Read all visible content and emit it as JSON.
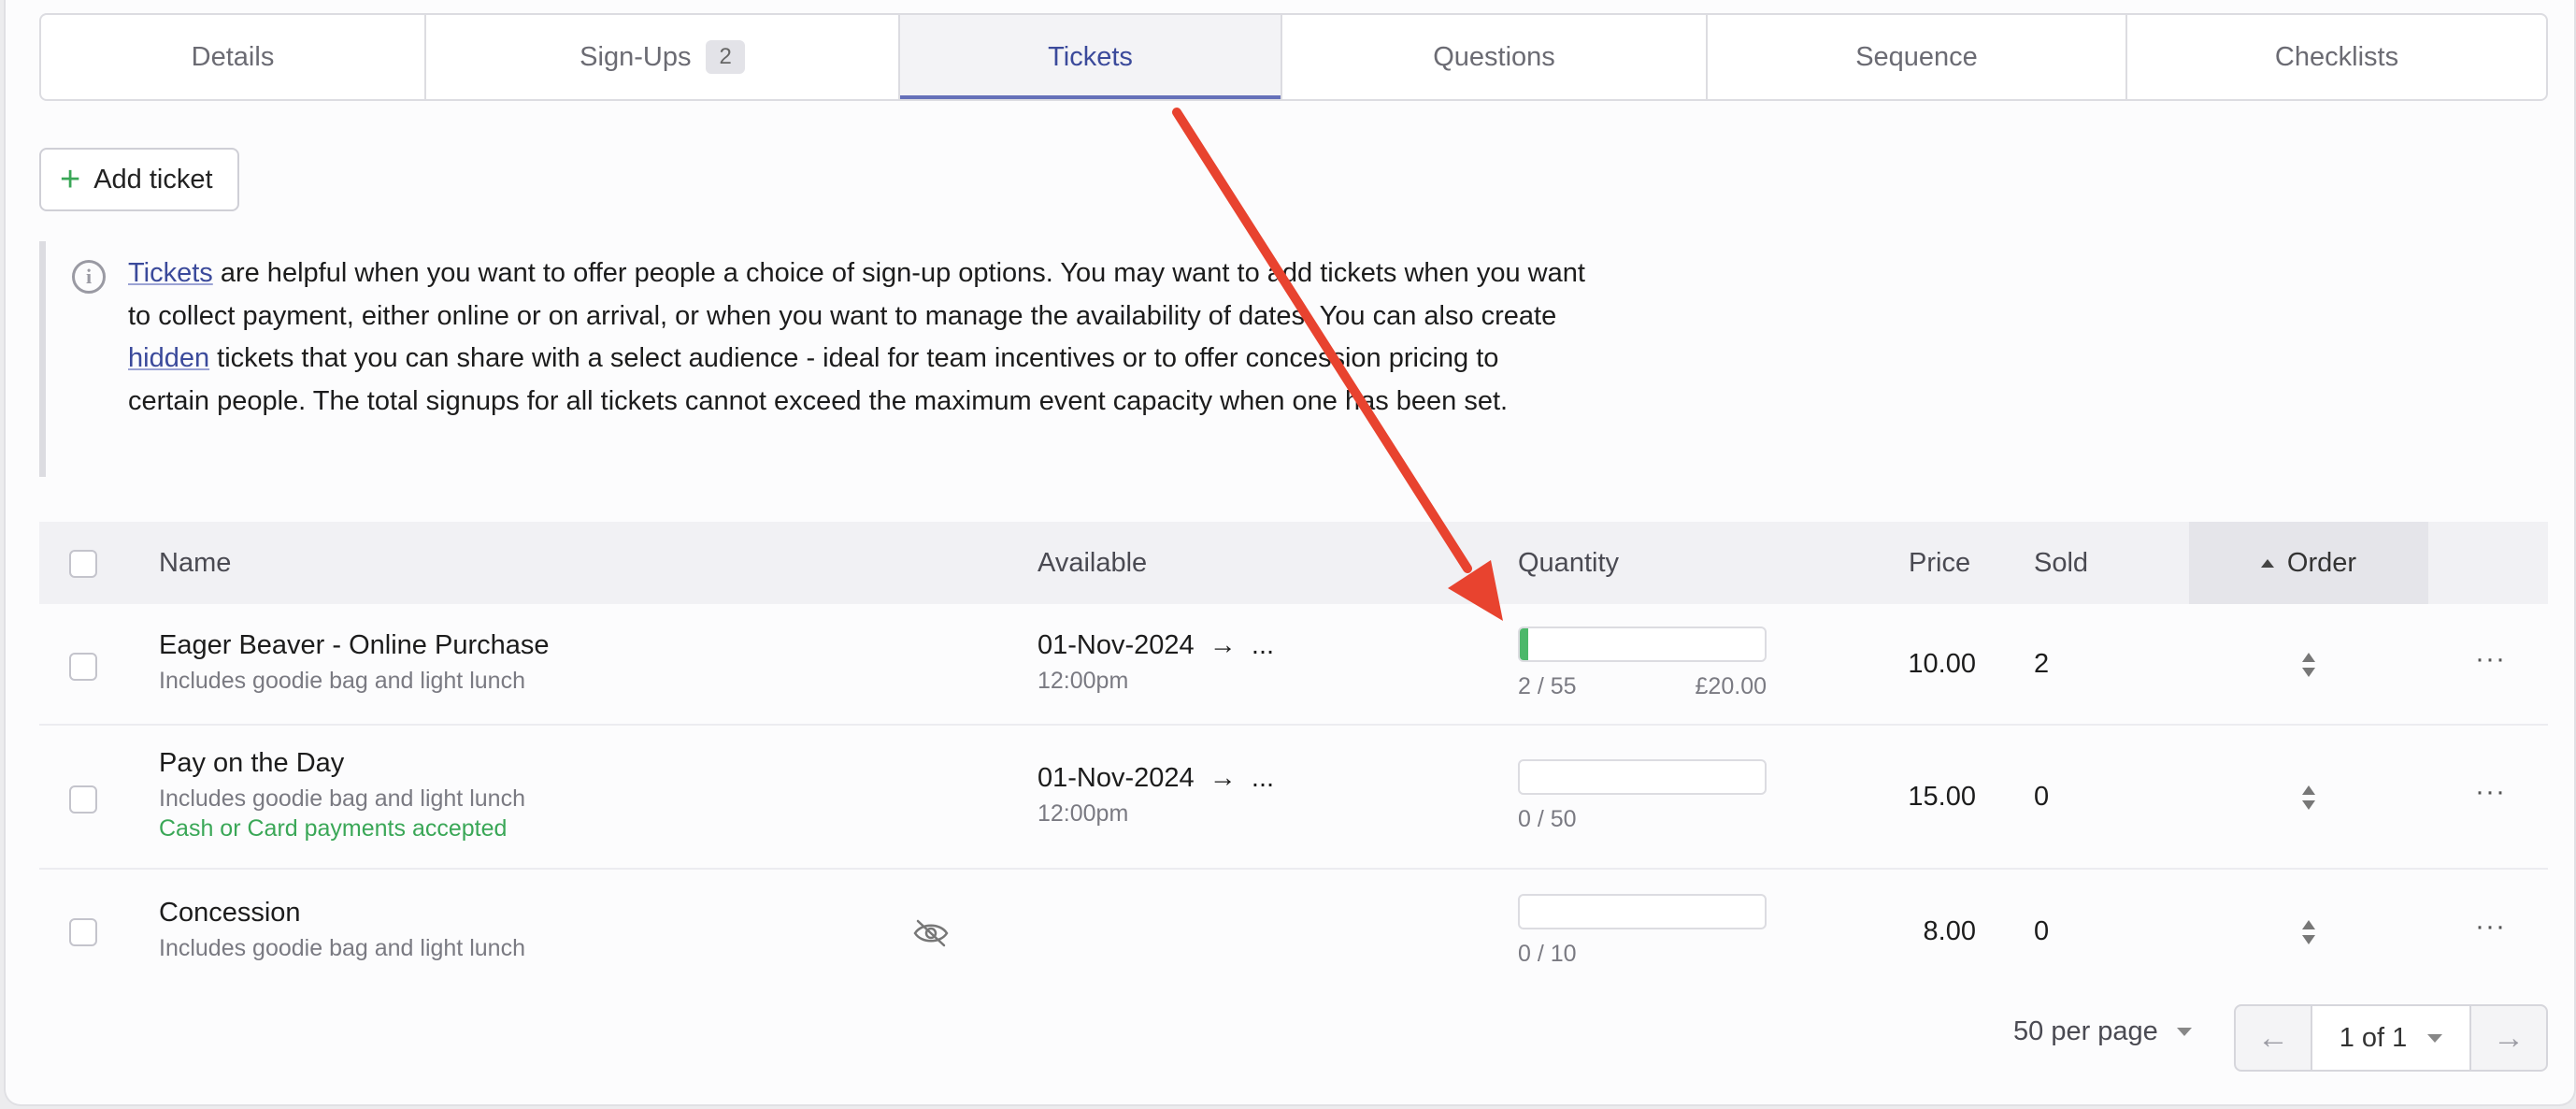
{
  "tabs": [
    {
      "label": "Details"
    },
    {
      "label": "Sign-Ups",
      "badge": "2"
    },
    {
      "label": "Tickets"
    },
    {
      "label": "Questions"
    },
    {
      "label": "Sequence"
    },
    {
      "label": "Checklists"
    }
  ],
  "add_ticket_label": "Add ticket",
  "note": {
    "link_tickets": "Tickets",
    "text_1": " are helpful when you want to offer people a choice of sign-up options. You may want to add tickets when you want to collect payment, either online or on arrival, or when you want to manage the availability of dates. You can also create ",
    "link_hidden": "hidden",
    "text_2": " tickets that you can share with a select audience - ideal for team incentives or to offer concession pricing to certain people. The total signups for all tickets cannot exceed the maximum event capacity when one has been set."
  },
  "table": {
    "headers": {
      "name": "Name",
      "available": "Available",
      "quantity": "Quantity",
      "price": "Price",
      "sold": "Sold",
      "order": "Order"
    },
    "rows": [
      {
        "name": "Eager Beaver - Online Purchase",
        "description": "Includes goodie bag and light lunch",
        "note": "",
        "hidden_icon": "",
        "date": "01-Nov-2024",
        "arrow": "→",
        "ellipsis": "...",
        "time": "12:00pm",
        "quantity_text": "2 / 55",
        "quantity_fraction": 0.036,
        "revenue": "£20.00",
        "price": "10.00",
        "sold": "2"
      },
      {
        "name": "Pay on the Day",
        "description": "Includes goodie bag and light lunch",
        "note": "Cash or Card payments accepted",
        "hidden_icon": "",
        "date": "01-Nov-2024",
        "arrow": "→",
        "ellipsis": "...",
        "time": "12:00pm",
        "quantity_text": "0 / 50",
        "quantity_fraction": 0,
        "revenue": "",
        "price": "15.00",
        "sold": "0"
      },
      {
        "name": "Concession",
        "description": "Includes goodie bag and light lunch",
        "note": "",
        "hidden_icon": "eye-slash-icon",
        "date": "",
        "arrow": "",
        "ellipsis": "",
        "time": "",
        "quantity_text": "0 / 10",
        "quantity_fraction": 0,
        "revenue": "",
        "price": "8.00",
        "sold": "0"
      }
    ]
  },
  "pagination": {
    "per_page": "50 per page",
    "page": "1 of 1",
    "prev": "←",
    "next": "→"
  },
  "colors": {
    "accent": "#6570b9",
    "progress": "#4cb86a",
    "annotation_arrow": "#e8432f"
  }
}
